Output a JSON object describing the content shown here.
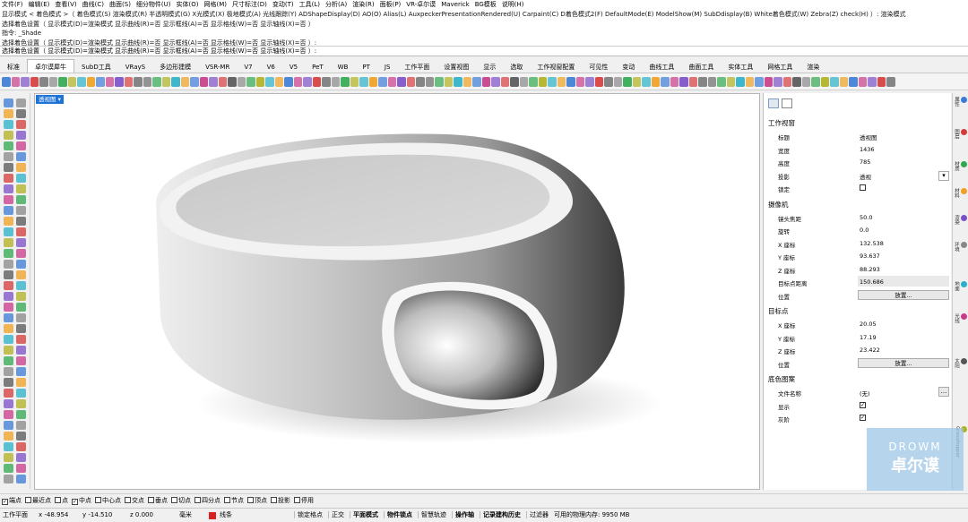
{
  "menubar": [
    "文件(F)",
    "编辑(E)",
    "查看(V)",
    "曲线(C)",
    "曲面(S)",
    "细分物件(U)",
    "实体(O)",
    "网格(M)",
    "尺寸标注(D)",
    "变动(T)",
    "工具(L)",
    "分析(A)",
    "渲染(R)",
    "面板(P)",
    "VR-卓尔谟",
    "Maverick",
    "BG模板",
    "说明(H)"
  ],
  "command_history": [
    "显示模式 < 着色模式 >（ 着色模式(S)  渲染模式(R)  半透明模式(G)  X光模式(X)  极地模式(A)  光线跟踪(Y)  ADShapeDisplay(D)  AO(O)  Alias(L)  AuxpeckerPresentationRendered(U)  Carpaint(C)  D着色模式2(F)  DefaultMode(E)  ModelShow(M)  SubDdisplay(B)  White着色模式(W)  Zebra(Z)  check(H) ）: 渲染模式",
    "选择着色设置（ 显示模式(D)=渲染模式  显示曲线(R)=否  显示框线(A)=否  显示格线(W)=否  显示轴线(X)=否 ）",
    "指令: _Shade",
    "选择着色设置（ 显示模式(D)=渲染模式  显示曲线(R)=否  显示框线(A)=否  显示格线(W)=否  显示轴线(X)=否 ）:"
  ],
  "tabs": [
    "标准",
    "卓尔谟犀牛",
    "SubD工具",
    "VRayS",
    "多边形建模",
    "VSR-MR",
    "V7",
    "V6",
    "V5",
    "PeT",
    "WB",
    "PT",
    "JS",
    "工作平面",
    "设置视图",
    "显示",
    "选取",
    "工作视窗配置",
    "可见性",
    "变动",
    "曲线工具",
    "曲面工具",
    "实体工具",
    "网格工具",
    "渲染"
  ],
  "active_tab": "卓尔谟犀牛",
  "viewport": {
    "label": "透视图"
  },
  "panel": {
    "section_viewport": "工作视窗",
    "rows_viewport": [
      {
        "label": "标题",
        "value": "透视图"
      },
      {
        "label": "宽度",
        "value": "1436"
      },
      {
        "label": "高度",
        "value": "785"
      },
      {
        "label": "投影",
        "value": "透视"
      },
      {
        "label": "锁定",
        "value": ""
      }
    ],
    "section_camera": "摄像机",
    "rows_camera": [
      {
        "label": "镜头焦距",
        "value": "50.0"
      },
      {
        "label": "旋转",
        "value": "0.0"
      },
      {
        "label": "X 座标",
        "value": "132.538"
      },
      {
        "label": "Y 座标",
        "value": "93.637"
      },
      {
        "label": "Z 座标",
        "value": "88.293"
      },
      {
        "label": "目标点距离",
        "value": "150.686"
      },
      {
        "label": "位置",
        "value": ""
      }
    ],
    "section_target": "目标点",
    "rows_target": [
      {
        "label": "X 座标",
        "value": "20.05"
      },
      {
        "label": "Y 座标",
        "value": "17.19"
      },
      {
        "label": "Z 座标",
        "value": "23.422"
      },
      {
        "label": "位置",
        "value": ""
      }
    ],
    "section_bg": "底色图案",
    "rows_bg": [
      {
        "label": "文件名称",
        "value": "(无)"
      },
      {
        "label": "显示",
        "value": ""
      },
      {
        "label": "灰阶",
        "value": ""
      }
    ],
    "place_button": "放置...",
    "browse_button": "..."
  },
  "right_strip": [
    "属性",
    "图层",
    "材质",
    "材料",
    "渲染",
    "环境",
    "地面",
    "光线",
    "太阳",
    "Grasshopper"
  ],
  "osnaps": [
    {
      "label": "端点",
      "checked": true
    },
    {
      "label": "最近点",
      "checked": false
    },
    {
      "label": "点",
      "checked": false
    },
    {
      "label": "中点",
      "checked": true
    },
    {
      "label": "中心点",
      "checked": false
    },
    {
      "label": "交点",
      "checked": false
    },
    {
      "label": "垂点",
      "checked": false
    },
    {
      "label": "切点",
      "checked": false
    },
    {
      "label": "四分点",
      "checked": false
    },
    {
      "label": "节点",
      "checked": false
    },
    {
      "label": "顶点",
      "checked": false
    },
    {
      "label": "投影",
      "checked": false
    },
    {
      "label": "停用",
      "checked": false
    }
  ],
  "status": {
    "cplane": "工作平面",
    "x": "x -48.954",
    "y": "y -14.510",
    "z": "z 0.000",
    "units": "毫米",
    "layer": "线条",
    "layer_color": "#d82020",
    "toggles": [
      "锁定格点",
      "正交",
      "平面模式",
      "物件锁点",
      "智慧轨迹",
      "操作轴",
      "记录建构历史",
      "过滤器"
    ],
    "memory": "可用的物理内存: 9950 MB"
  },
  "logo": {
    "top": "DROWM",
    "bottom": "卓尔谟"
  }
}
